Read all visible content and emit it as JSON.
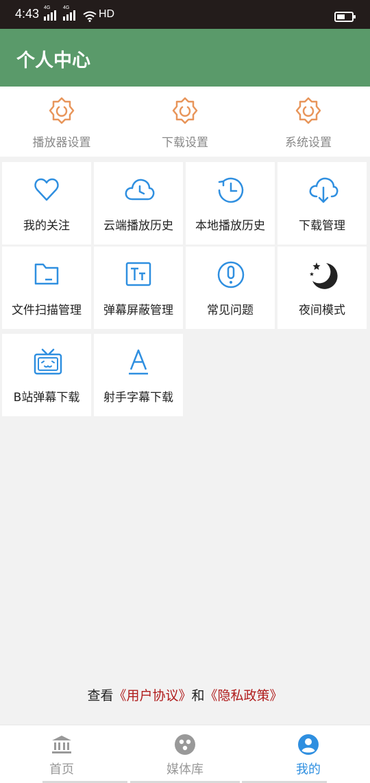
{
  "status_bar": {
    "time": "4:43",
    "network1": "4G",
    "network2": "4G",
    "hd": "HD",
    "battery_level": 0.55
  },
  "header": {
    "title": "个人中心"
  },
  "settings": [
    {
      "label": "播放器设置",
      "icon": "gear-icon"
    },
    {
      "label": "下载设置",
      "icon": "gear-icon"
    },
    {
      "label": "系统设置",
      "icon": "gear-icon"
    }
  ],
  "tiles": [
    {
      "label": "我的关注",
      "icon": "heart-icon"
    },
    {
      "label": "云端播放历史",
      "icon": "cloud-clock-icon"
    },
    {
      "label": "本地播放历史",
      "icon": "history-icon"
    },
    {
      "label": "下载管理",
      "icon": "cloud-download-icon"
    },
    {
      "label": "文件扫描管理",
      "icon": "folder-icon"
    },
    {
      "label": "弹幕屏蔽管理",
      "icon": "text-icon"
    },
    {
      "label": "常见问题",
      "icon": "exclamation-icon"
    },
    {
      "label": "夜间模式",
      "icon": "moon-stars-icon"
    },
    {
      "label": "B站弹幕下载",
      "icon": "tv-icon"
    },
    {
      "label": "射手字幕下载",
      "icon": "letter-a-icon"
    }
  ],
  "agreement": {
    "prefix": "查看",
    "user_agreement": "《用户协议》",
    "connector": "和",
    "privacy_policy": "《隐私政策》"
  },
  "bottom_nav": [
    {
      "label": "首页",
      "icon": "bank-icon",
      "active": false
    },
    {
      "label": "媒体库",
      "icon": "media-library-icon",
      "active": false
    },
    {
      "label": "我的",
      "icon": "user-icon",
      "active": true
    }
  ],
  "colors": {
    "header": "#5a9a6a",
    "accent_blue": "#2f8fe0",
    "gear_orange": "#e8955a",
    "link_red": "#b01c1c"
  }
}
